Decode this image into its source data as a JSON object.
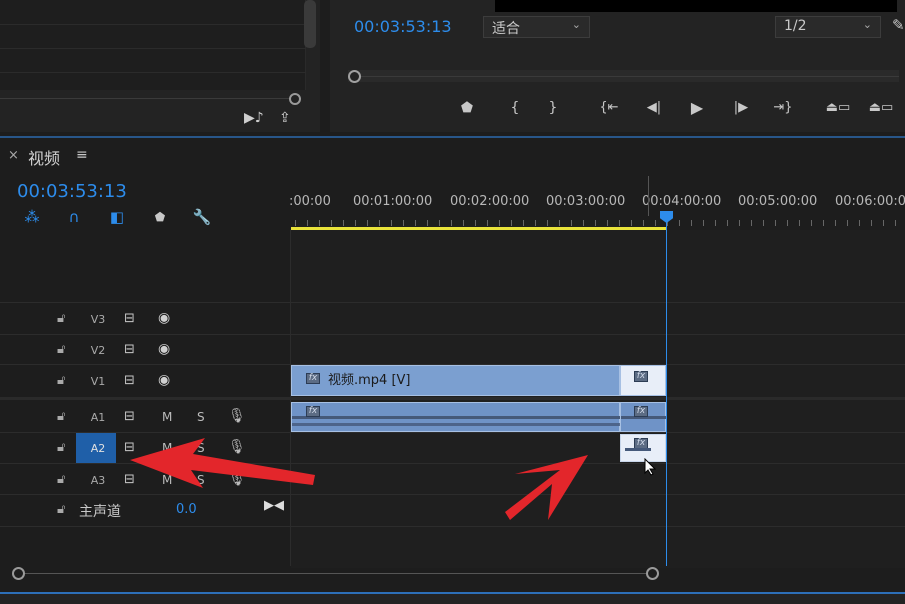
{
  "program": {
    "timecode": "00:03:53:13",
    "fit_select": "适合",
    "res_select": "1/2",
    "controls": [
      {
        "name": "add-marker-icon",
        "glyph": "⬟"
      },
      {
        "name": "mark-in-icon",
        "glyph": "{"
      },
      {
        "name": "mark-out-icon",
        "glyph": "}"
      },
      {
        "name": "go-to-in-icon",
        "glyph": "{⇤"
      },
      {
        "name": "step-back-icon",
        "glyph": "◀|"
      },
      {
        "name": "play-icon",
        "glyph": "▶"
      },
      {
        "name": "step-forward-icon",
        "glyph": "|▶"
      },
      {
        "name": "go-to-out-icon",
        "glyph": "⇥}"
      },
      {
        "name": "lift-icon",
        "glyph": "⏏"
      },
      {
        "name": "extract-icon",
        "glyph": "⏏"
      }
    ]
  },
  "timeline": {
    "tab_close": "×",
    "tab_name": "视频",
    "tab_menu": "≡",
    "timecode": "00:03:53:13",
    "ruler_labels": [
      ":00:00",
      "00:01:00:00",
      "00:02:00:00",
      "00:03:00:00",
      "00:04:00:00",
      "00:05:00:00",
      "00:06:00:00"
    ],
    "tracks": {
      "v3": "V3",
      "v2": "V2",
      "v1": "V1",
      "a1": "A1",
      "a2": "A2",
      "a3": "A3"
    },
    "mute_label": "M",
    "solo_label": "S",
    "master_label": "主声道",
    "master_value": "0.0",
    "clip_v1_name": "视频.mp4 [V]",
    "fx_label": "fx"
  },
  "colors": {
    "accent": "#2d8ceb",
    "clip": "#7b9fd0",
    "work_area": "#e8e23a",
    "arrow": "#e3262b"
  }
}
